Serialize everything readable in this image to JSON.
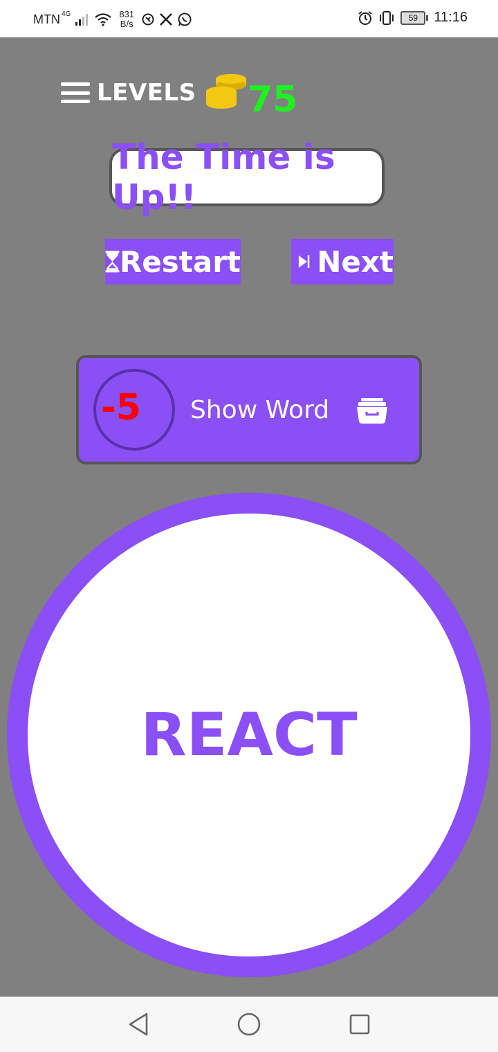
{
  "status_bar": {
    "carrier": "MTN",
    "network": "4G",
    "speed_value": "831",
    "speed_unit": "B/s",
    "battery": "59",
    "time": "11:16"
  },
  "header": {
    "levels_label": "LEVELS",
    "coins": "75"
  },
  "game": {
    "status_message": "The Time is Up!!",
    "restart_label": "Restart",
    "next_label": "Next",
    "hint_cost": "-5",
    "hint_label": "Show Word",
    "word": "REACT"
  },
  "icons": {
    "menu": "hamburger-menu-icon",
    "coins": "coin-stack-icon",
    "restart": "hourglass-icon",
    "next": "skip-next-icon",
    "hint": "archive-box-icon",
    "back": "back-triangle-icon",
    "home": "home-circle-icon",
    "recents": "recents-square-icon"
  },
  "colors": {
    "background": "#808080",
    "accent": "#8a4ff5",
    "coins_text": "#1ff01f",
    "coin_gold": "#f2c811",
    "hint_cost": "#ff0000",
    "white": "#ffffff"
  }
}
